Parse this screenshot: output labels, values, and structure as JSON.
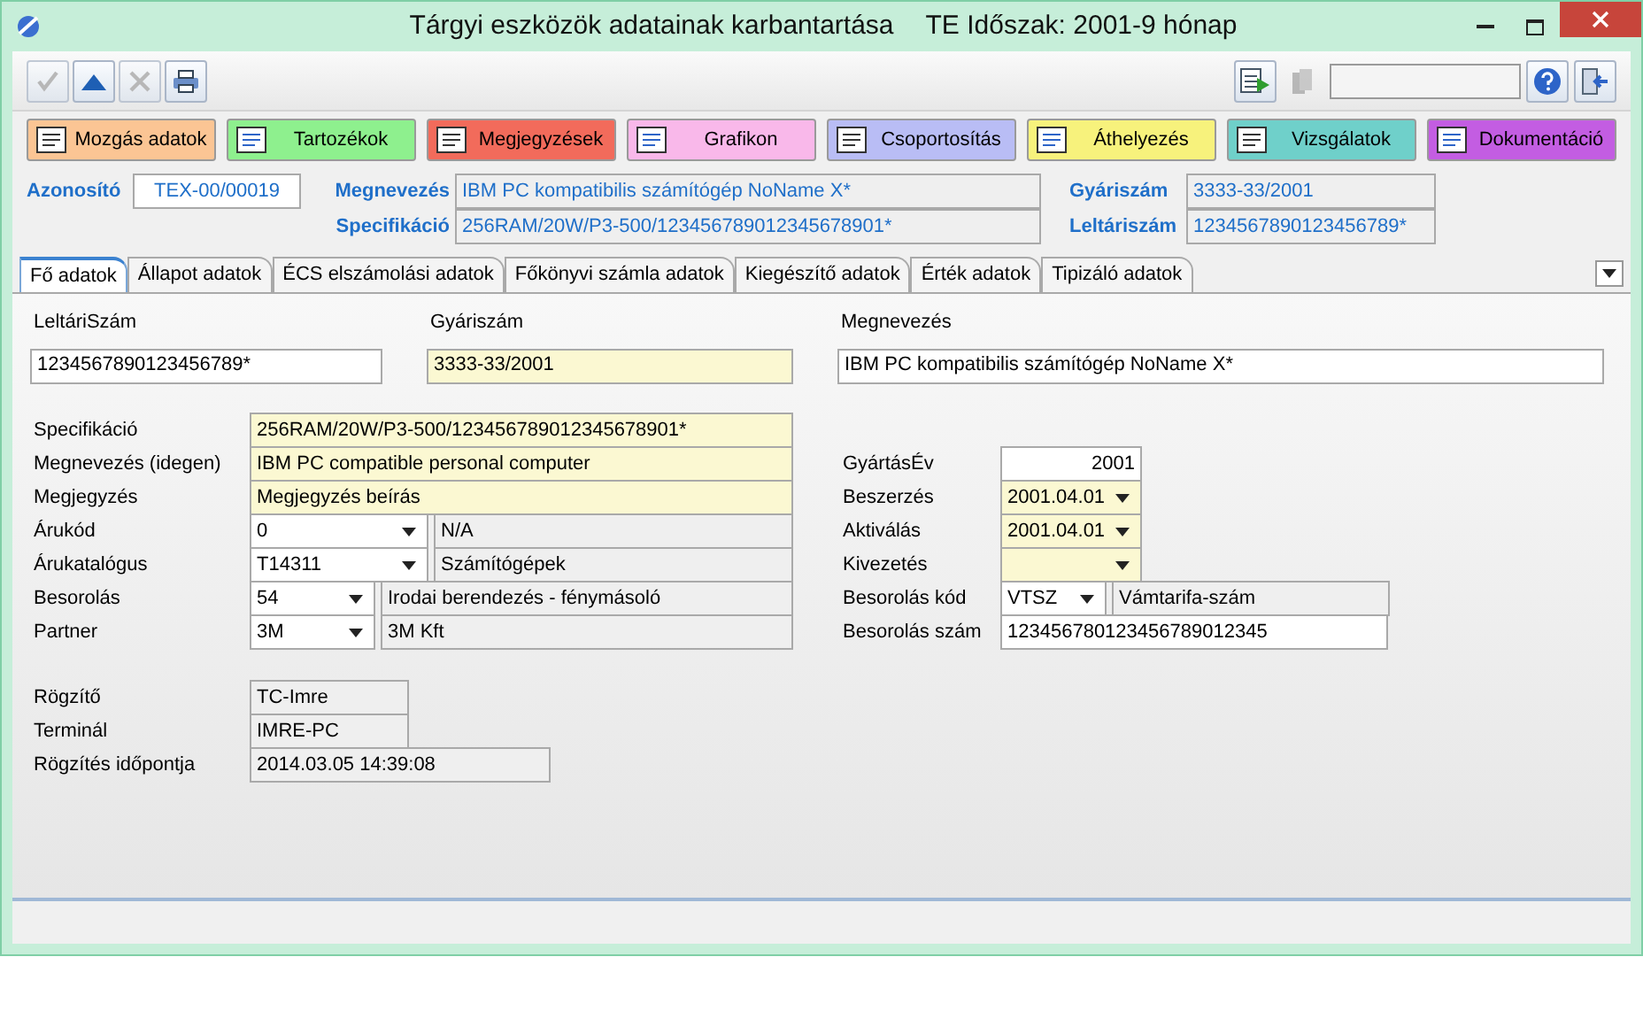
{
  "window": {
    "title": "Tárgyi eszközök adatainak karbantartása",
    "period": "TE Időszak: 2001-9 hónap"
  },
  "toolbar": {
    "left": [
      {
        "kind": "confirm",
        "disabled": true
      },
      {
        "kind": "up",
        "disabled": false
      },
      {
        "kind": "cancel",
        "disabled": true
      },
      {
        "kind": "print",
        "disabled": false
      }
    ],
    "right": [
      {
        "kind": "export",
        "disabled": false
      },
      {
        "kind": "copy",
        "disabled": true
      },
      {
        "kind": "field"
      },
      {
        "kind": "help",
        "disabled": false
      },
      {
        "kind": "exit",
        "disabled": false
      }
    ]
  },
  "action_buttons": [
    {
      "label": "Mozgás adatok",
      "color": "#fbc594"
    },
    {
      "label": "Tartozékok",
      "color": "#8ef08e"
    },
    {
      "label": "Megjegyzések",
      "color": "#f26b5b"
    },
    {
      "label": "Grafikon",
      "color": "#f9b8ea"
    },
    {
      "label": "Csoportosítás",
      "color": "#b9bdf5"
    },
    {
      "label": "Áthelyezés",
      "color": "#f7f27c"
    },
    {
      "label": "Vizsgálatok",
      "color": "#6fd0ca"
    },
    {
      "label": "Dokumentáció",
      "color": "#c35de2"
    }
  ],
  "header": {
    "id_label": "Azonosító",
    "id_value": "TEX-00/00019",
    "middle": [
      {
        "label": "Megnevezés",
        "value": "IBM PC kompatibilis számítógép NoName X*"
      },
      {
        "label": "Specifikáció",
        "value": "256RAM/20W/P3-500/123456789012345678901*"
      }
    ],
    "right": [
      {
        "label": "Gyáriszám",
        "value": "3333-33/2001"
      },
      {
        "label": "Leltáriszám",
        "value": "1234567890123456789*"
      }
    ]
  },
  "tabs": [
    {
      "label": "Fő adatok",
      "selected": true
    },
    {
      "label": "Állapot adatok",
      "selected": false
    },
    {
      "label": "ÉCS elszámolási adatok",
      "selected": false
    },
    {
      "label": "Főkönyvi számla adatok",
      "selected": false
    },
    {
      "label": "Kiegészítő adatok",
      "selected": false
    },
    {
      "label": "Érték adatok",
      "selected": false
    },
    {
      "label": "Tipizáló adatok",
      "selected": false
    }
  ],
  "form": {
    "top": [
      {
        "label": "LeltáriSzám",
        "field": {
          "value": "1234567890123456789*",
          "kind": "input",
          "dropdown": false
        }
      },
      {
        "label": "Gyáriszám",
        "field": {
          "value": "3333-33/2001",
          "kind": "required",
          "dropdown": false
        }
      },
      {
        "label": "Megnevezés",
        "field": {
          "value": "IBM PC kompatibilis számítógép NoName X*",
          "kind": "input",
          "dropdown": false
        }
      }
    ],
    "left": [
      {
        "label": "Specifikáció",
        "fields": [
          {
            "value": "256RAM/20W/P3-500/123456789012345678901*",
            "kind": "required",
            "dropdown": false
          }
        ]
      },
      {
        "label": "Megnevezés (idegen)",
        "fields": [
          {
            "value": "IBM PC compatible personal computer",
            "kind": "required",
            "dropdown": false
          }
        ]
      },
      {
        "label": "Megjegyzés",
        "fields": [
          {
            "value": "Megjegyzés beírás",
            "kind": "required",
            "dropdown": false
          }
        ]
      },
      {
        "label": "Árukód",
        "fields": [
          {
            "value": "0",
            "kind": "input",
            "dropdown": true
          },
          {
            "value": "N/A",
            "kind": "display",
            "dropdown": false
          }
        ]
      },
      {
        "label": "Árukatalógus",
        "fields": [
          {
            "value": "T14311",
            "kind": "input",
            "dropdown": true
          },
          {
            "value": "Számítógépek",
            "kind": "display",
            "dropdown": false
          }
        ]
      },
      {
        "label": "Besorolás",
        "fields": [
          {
            "value": "54",
            "kind": "input",
            "dropdown": true
          },
          {
            "value": "Irodai berendezés - fénymásoló",
            "kind": "display",
            "dropdown": false
          }
        ]
      },
      {
        "label": "Partner",
        "fields": [
          {
            "value": "3M",
            "kind": "input",
            "dropdown": true
          },
          {
            "value": "3M Kft",
            "kind": "display",
            "dropdown": false
          }
        ]
      }
    ],
    "right": [
      {
        "label": "GyártásÉv",
        "fields": [
          {
            "value": "2001",
            "kind": "number",
            "dropdown": false
          }
        ]
      },
      {
        "label": "Beszerzés",
        "fields": [
          {
            "value": "2001.04.01",
            "kind": "required",
            "dropdown": true
          }
        ]
      },
      {
        "label": "Aktiválás",
        "fields": [
          {
            "value": "2001.04.01",
            "kind": "required",
            "dropdown": true
          }
        ]
      },
      {
        "label": "Kivezetés",
        "fields": [
          {
            "kind": "required",
            "dropdown": true
          }
        ]
      },
      {
        "label": "Besorolás kód",
        "fields": [
          {
            "value": "VTSZ",
            "kind": "input",
            "dropdown": true
          },
          {
            "value": "Vámtarifa-szám",
            "kind": "display",
            "dropdown": false
          }
        ]
      },
      {
        "label": "Besorolás szám",
        "fields": [
          {
            "value": "123456780123456789012345",
            "kind": "input",
            "dropdown": false
          }
        ]
      }
    ],
    "audit": [
      {
        "label": "Rögzítő",
        "fields": [
          {
            "value": "TC-Imre",
            "kind": "display",
            "dropdown": false
          }
        ]
      },
      {
        "label": "Terminál",
        "fields": [
          {
            "value": "IMRE-PC",
            "kind": "display",
            "dropdown": false
          }
        ]
      },
      {
        "label": "Rögzítés időpontja",
        "fields": [
          {
            "value": "2014.03.05 14:39:08",
            "kind": "display",
            "dropdown": false
          }
        ]
      }
    ]
  }
}
